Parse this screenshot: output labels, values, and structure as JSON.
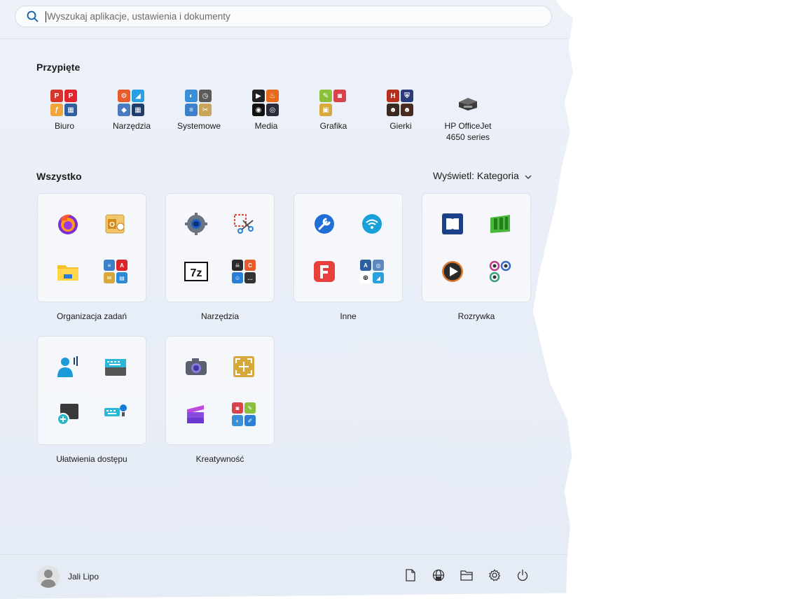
{
  "search": {
    "placeholder": "Wyszukaj aplikacje, ustawienia i dokumenty",
    "icon": "search-icon"
  },
  "pinned": {
    "title": "Przypięte",
    "items": [
      {
        "label": "Biuro"
      },
      {
        "label": "Narzędzia"
      },
      {
        "label": "Systemowe"
      },
      {
        "label": "Media"
      },
      {
        "label": "Grafika"
      },
      {
        "label": "Gierki"
      },
      {
        "label": "HP OfficeJet 4650 series"
      }
    ]
  },
  "all": {
    "title": "Wszystko",
    "view_label": "Wyświetl: Kategoria",
    "folders": [
      {
        "label": "Organizacja zadań"
      },
      {
        "label": "Narzędzia"
      },
      {
        "label": "Inne"
      },
      {
        "label": "Rozrywka"
      },
      {
        "label": "Ułatwienia dostępu"
      },
      {
        "label": "Kreatywność"
      }
    ]
  },
  "footer": {
    "user_name": "Jali Lipo",
    "icons": [
      "document-icon",
      "globe-icon",
      "folder-icon",
      "gear-icon",
      "power-icon"
    ]
  },
  "colors": {
    "accent": "#0067c0",
    "panel": "#eef1f8"
  }
}
